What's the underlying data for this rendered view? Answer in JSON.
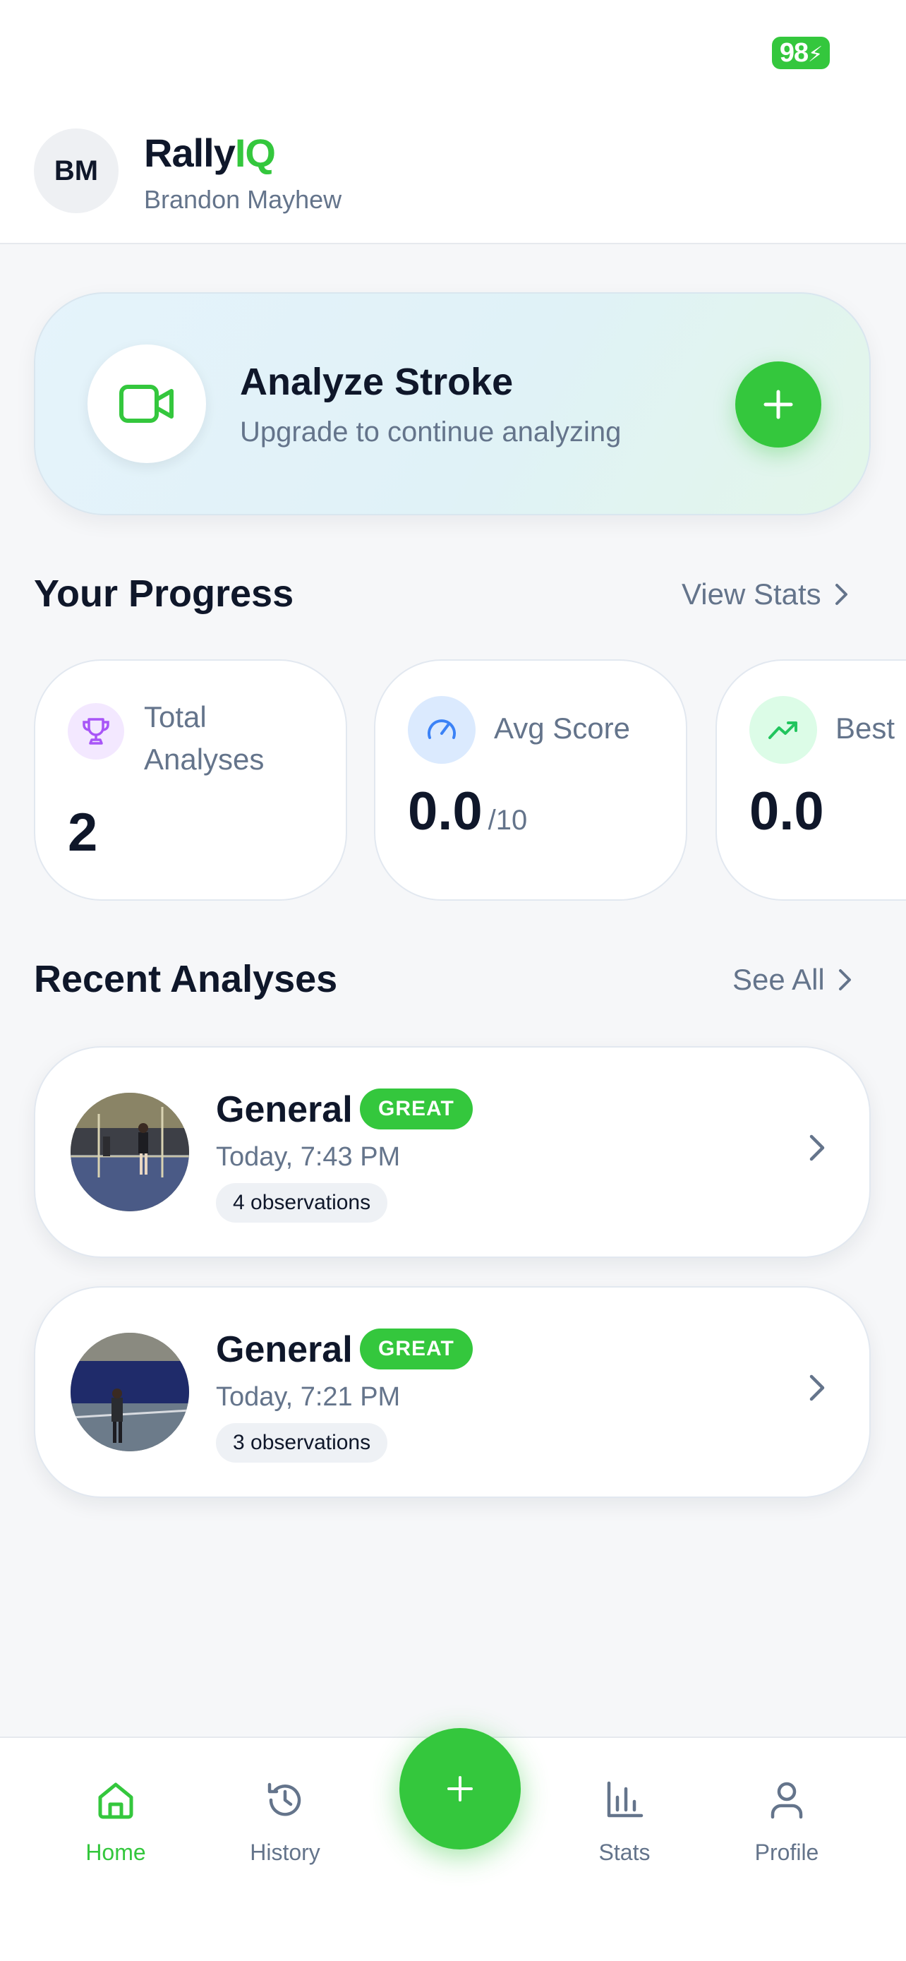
{
  "status_bar": {
    "battery": "98"
  },
  "header": {
    "avatar_initials": "BM",
    "app_name_main": "Rally",
    "app_name_accent": "IQ",
    "user_name": "Brandon Mayhew"
  },
  "analyze": {
    "title": "Analyze Stroke",
    "subtitle": "Upgrade to continue analyzing",
    "icon": "video-camera-icon"
  },
  "progress": {
    "title": "Your Progress",
    "link": "View Stats",
    "cards": [
      {
        "label_line1": "Total",
        "label_line2": "Analyses",
        "value": "2",
        "icon": "trophy-icon"
      },
      {
        "label": "Avg Score",
        "value": "0.0",
        "unit": "/10",
        "icon": "gauge-icon"
      },
      {
        "label": "Best",
        "value": "0.0",
        "icon": "trending-up-icon"
      }
    ]
  },
  "recent": {
    "title": "Recent Analyses",
    "link": "See All",
    "items": [
      {
        "title": "General",
        "badge": "GREAT",
        "time": "Today, 7:43 PM",
        "observations": "4 observations"
      },
      {
        "title": "General",
        "badge": "GREAT",
        "time": "Today, 7:21 PM",
        "observations": "3 observations"
      }
    ]
  },
  "nav": {
    "home": "Home",
    "history": "History",
    "stats": "Stats",
    "profile": "Profile"
  },
  "colors": {
    "accent": "#34c73d",
    "text_primary": "#0f172a",
    "text_secondary": "#64748b",
    "trophy_bg": "#f3e8ff",
    "trophy": "#a855f7",
    "gauge_bg": "#dbeafe",
    "gauge": "#3b82f6",
    "trend_bg": "#dcfce7"
  }
}
